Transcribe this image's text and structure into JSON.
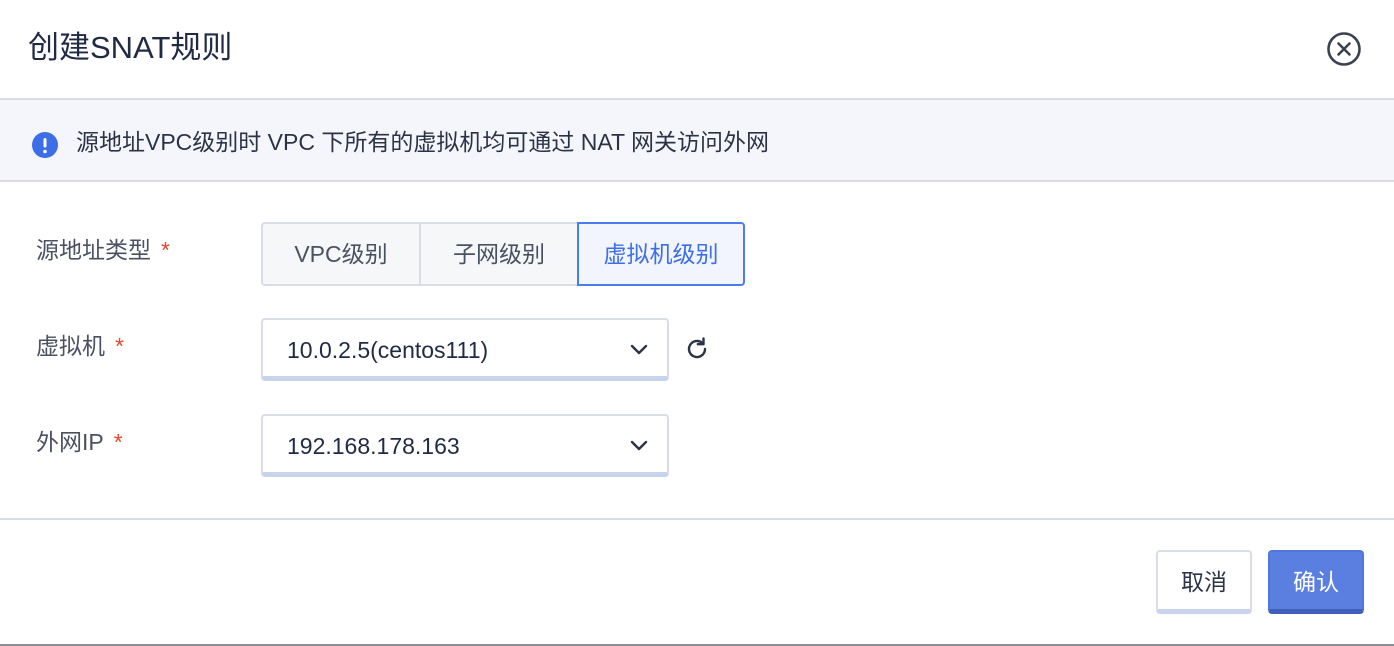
{
  "dialog": {
    "title": "创建SNAT规则",
    "close_icon": "close-circle-icon"
  },
  "notice": {
    "icon": "info-icon",
    "text": "源地址VPC级别时 VPC 下所有的虚拟机均可通过 NAT 网关访问外网"
  },
  "form": {
    "source_type": {
      "label": "源地址类型",
      "required_mark": "*",
      "options": [
        "VPC级别",
        "子网级别",
        "虚拟机级别"
      ],
      "selected": "虚拟机级别"
    },
    "vm": {
      "label": "虚拟机",
      "required_mark": "*",
      "value": "10.0.2.5(centos111)",
      "refresh_icon": "refresh-icon"
    },
    "public_ip": {
      "label": "外网IP",
      "required_mark": "*",
      "value": "192.168.178.163"
    }
  },
  "footer": {
    "cancel_label": "取消",
    "confirm_label": "确认"
  },
  "colors": {
    "accent": "#4a7cf0",
    "primary_button": "#5a7fe0",
    "required": "#e5482a",
    "notice_bg": "#f4f6fb"
  }
}
